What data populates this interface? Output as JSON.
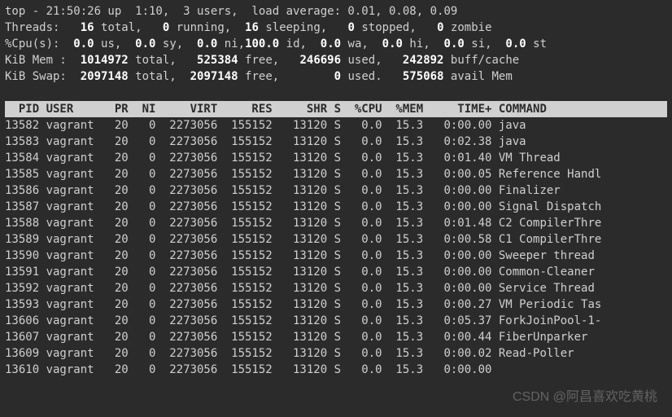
{
  "summary": {
    "line1_time": "top - 21:50:26 up  1:10,  3 users,  load average: 0.01, 0.08, 0.09",
    "threads": {
      "prefix": "Threads:",
      "total": "16",
      "running": "0",
      "sleeping": "16",
      "stopped": "0",
      "zombie": "0"
    },
    "cpu": {
      "prefix": "%Cpu(s):",
      "us": "0.0",
      "sy": "0.0",
      "ni": "0.0",
      "id": "100.0",
      "wa": "0.0",
      "hi": "0.0",
      "si": "0.0",
      "st": "0.0"
    },
    "mem": {
      "prefix": "KiB Mem :",
      "total": "1014972",
      "free": "525384",
      "used": "246696",
      "buff": "242892"
    },
    "swap": {
      "prefix": "KiB Swap:",
      "total": "2097148",
      "free": "2097148",
      "used": "0",
      "avail": "575068"
    }
  },
  "header": {
    "pid": "PID",
    "user": "USER",
    "pr": "PR",
    "ni": "NI",
    "virt": "VIRT",
    "res": "RES",
    "shr": "SHR",
    "s": "S",
    "cpu": "%CPU",
    "mem": "%MEM",
    "time": "TIME+",
    "cmd": "COMMAND"
  },
  "rows": [
    {
      "pid": "13582",
      "user": "vagrant",
      "pr": "20",
      "ni": "0",
      "virt": "2273056",
      "res": "155152",
      "shr": "13120",
      "s": "S",
      "cpu": "0.0",
      "mem": "15.3",
      "time": "0:00.00",
      "cmd": "java"
    },
    {
      "pid": "13583",
      "user": "vagrant",
      "pr": "20",
      "ni": "0",
      "virt": "2273056",
      "res": "155152",
      "shr": "13120",
      "s": "S",
      "cpu": "0.0",
      "mem": "15.3",
      "time": "0:02.38",
      "cmd": "java"
    },
    {
      "pid": "13584",
      "user": "vagrant",
      "pr": "20",
      "ni": "0",
      "virt": "2273056",
      "res": "155152",
      "shr": "13120",
      "s": "S",
      "cpu": "0.0",
      "mem": "15.3",
      "time": "0:01.40",
      "cmd": "VM Thread"
    },
    {
      "pid": "13585",
      "user": "vagrant",
      "pr": "20",
      "ni": "0",
      "virt": "2273056",
      "res": "155152",
      "shr": "13120",
      "s": "S",
      "cpu": "0.0",
      "mem": "15.3",
      "time": "0:00.05",
      "cmd": "Reference Handl"
    },
    {
      "pid": "13586",
      "user": "vagrant",
      "pr": "20",
      "ni": "0",
      "virt": "2273056",
      "res": "155152",
      "shr": "13120",
      "s": "S",
      "cpu": "0.0",
      "mem": "15.3",
      "time": "0:00.00",
      "cmd": "Finalizer"
    },
    {
      "pid": "13587",
      "user": "vagrant",
      "pr": "20",
      "ni": "0",
      "virt": "2273056",
      "res": "155152",
      "shr": "13120",
      "s": "S",
      "cpu": "0.0",
      "mem": "15.3",
      "time": "0:00.00",
      "cmd": "Signal Dispatch"
    },
    {
      "pid": "13588",
      "user": "vagrant",
      "pr": "20",
      "ni": "0",
      "virt": "2273056",
      "res": "155152",
      "shr": "13120",
      "s": "S",
      "cpu": "0.0",
      "mem": "15.3",
      "time": "0:01.48",
      "cmd": "C2 CompilerThre"
    },
    {
      "pid": "13589",
      "user": "vagrant",
      "pr": "20",
      "ni": "0",
      "virt": "2273056",
      "res": "155152",
      "shr": "13120",
      "s": "S",
      "cpu": "0.0",
      "mem": "15.3",
      "time": "0:00.58",
      "cmd": "C1 CompilerThre"
    },
    {
      "pid": "13590",
      "user": "vagrant",
      "pr": "20",
      "ni": "0",
      "virt": "2273056",
      "res": "155152",
      "shr": "13120",
      "s": "S",
      "cpu": "0.0",
      "mem": "15.3",
      "time": "0:00.00",
      "cmd": "Sweeper thread"
    },
    {
      "pid": "13591",
      "user": "vagrant",
      "pr": "20",
      "ni": "0",
      "virt": "2273056",
      "res": "155152",
      "shr": "13120",
      "s": "S",
      "cpu": "0.0",
      "mem": "15.3",
      "time": "0:00.00",
      "cmd": "Common-Cleaner"
    },
    {
      "pid": "13592",
      "user": "vagrant",
      "pr": "20",
      "ni": "0",
      "virt": "2273056",
      "res": "155152",
      "shr": "13120",
      "s": "S",
      "cpu": "0.0",
      "mem": "15.3",
      "time": "0:00.00",
      "cmd": "Service Thread"
    },
    {
      "pid": "13593",
      "user": "vagrant",
      "pr": "20",
      "ni": "0",
      "virt": "2273056",
      "res": "155152",
      "shr": "13120",
      "s": "S",
      "cpu": "0.0",
      "mem": "15.3",
      "time": "0:00.27",
      "cmd": "VM Periodic Tas"
    },
    {
      "pid": "13606",
      "user": "vagrant",
      "pr": "20",
      "ni": "0",
      "virt": "2273056",
      "res": "155152",
      "shr": "13120",
      "s": "S",
      "cpu": "0.0",
      "mem": "15.3",
      "time": "0:05.37",
      "cmd": "ForkJoinPool-1-"
    },
    {
      "pid": "13607",
      "user": "vagrant",
      "pr": "20",
      "ni": "0",
      "virt": "2273056",
      "res": "155152",
      "shr": "13120",
      "s": "S",
      "cpu": "0.0",
      "mem": "15.3",
      "time": "0:00.44",
      "cmd": "FiberUnparker"
    },
    {
      "pid": "13609",
      "user": "vagrant",
      "pr": "20",
      "ni": "0",
      "virt": "2273056",
      "res": "155152",
      "shr": "13120",
      "s": "S",
      "cpu": "0.0",
      "mem": "15.3",
      "time": "0:00.02",
      "cmd": "Read-Poller"
    },
    {
      "pid": "13610",
      "user": "vagrant",
      "pr": "20",
      "ni": "0",
      "virt": "2273056",
      "res": "155152",
      "shr": "13120",
      "s": "S",
      "cpu": "0.0",
      "mem": "15.3",
      "time": "0:00.00",
      "cmd": ""
    }
  ],
  "watermark": "CSDN @阿昌喜欢吃黄桃"
}
